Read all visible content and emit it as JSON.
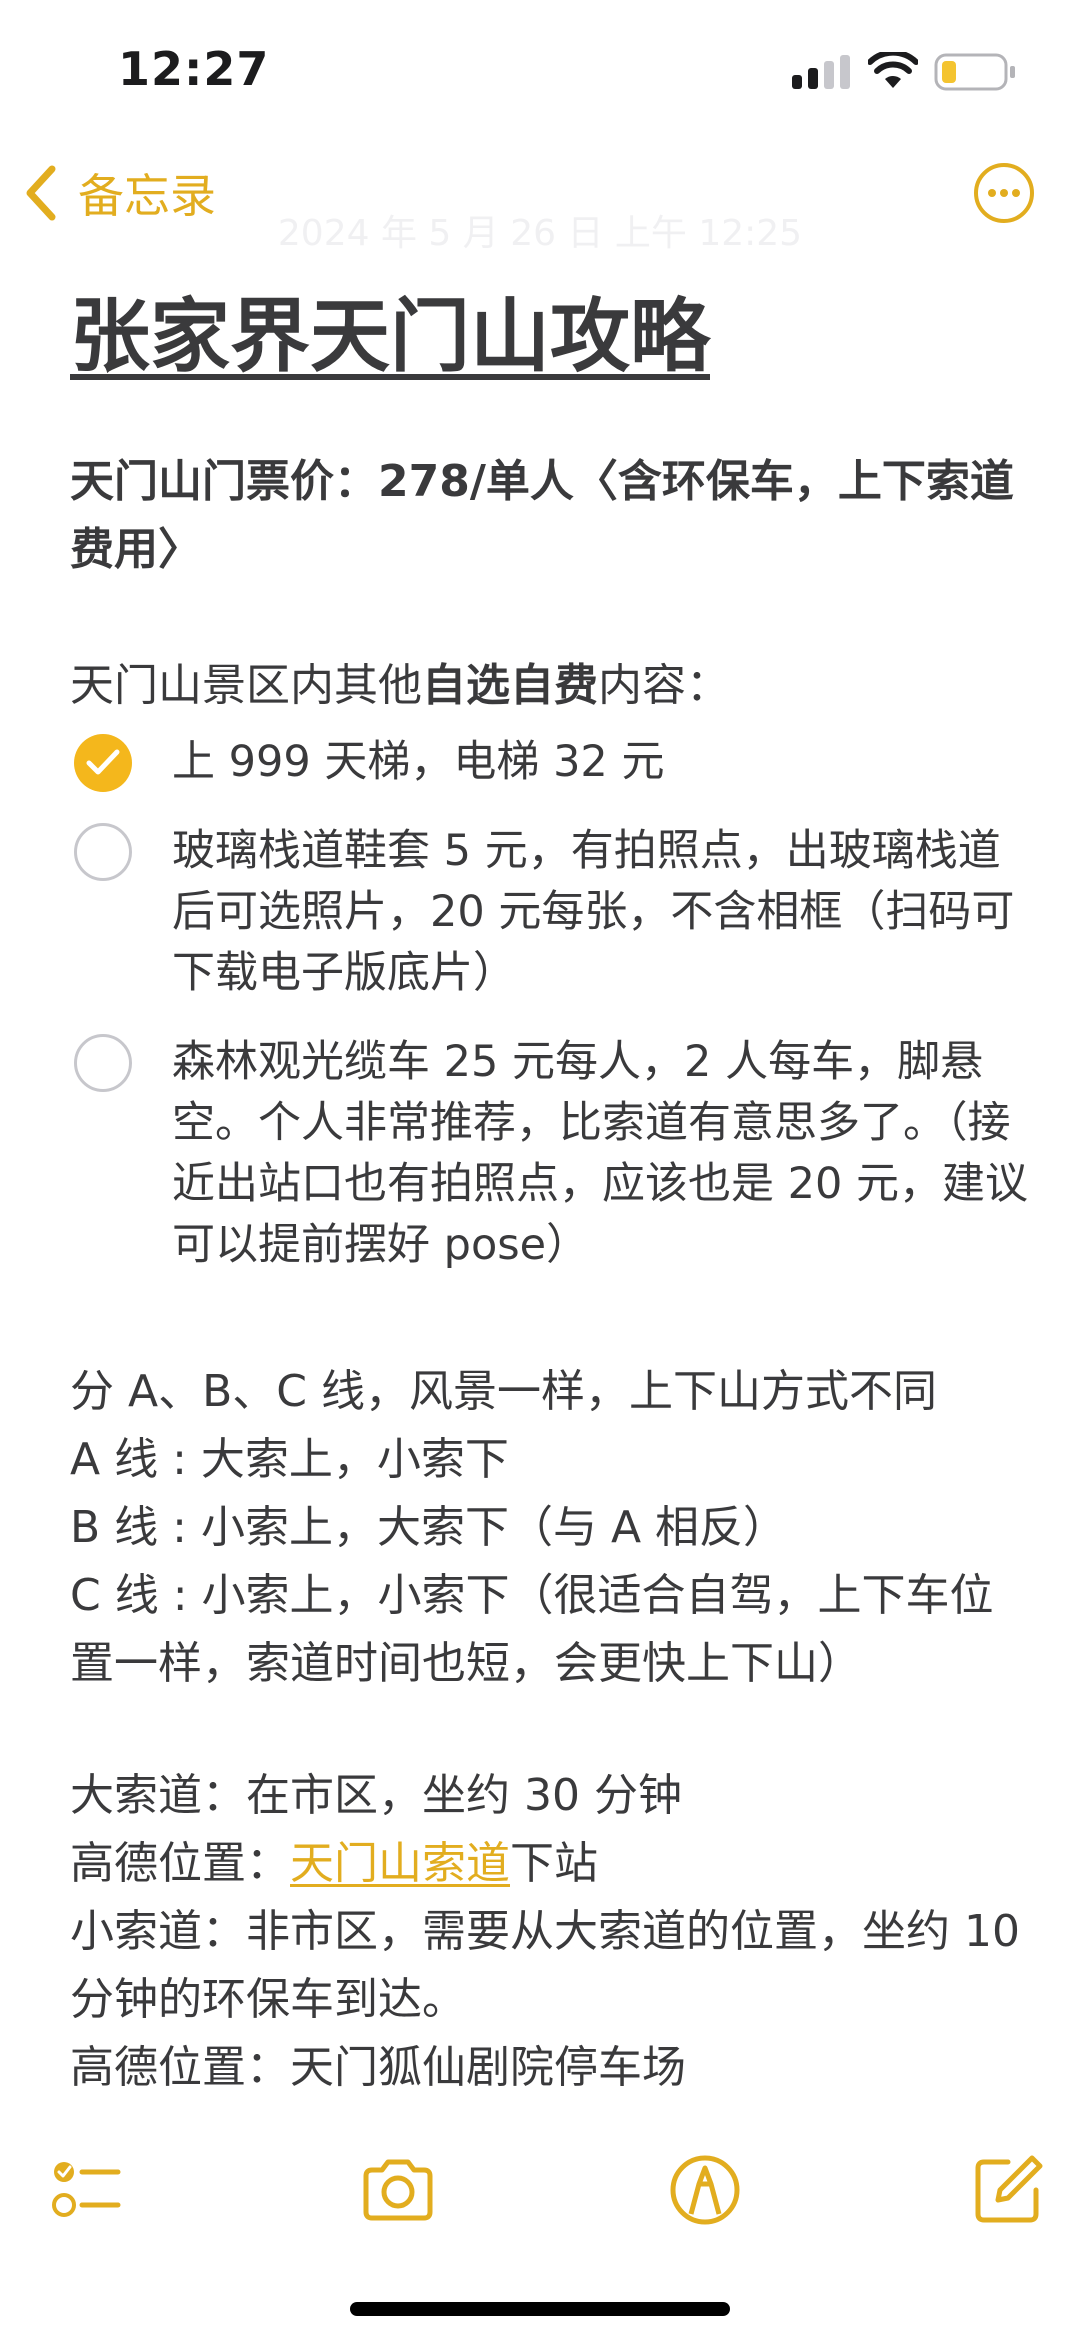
{
  "status_bar": {
    "time": "12:27"
  },
  "nav": {
    "back_label": "备忘录",
    "date_ghost": "2024 年 5 月 26 日 上午 12:25"
  },
  "note": {
    "title": "张家界天门山攻略",
    "ticket": {
      "label": "天门山门票价：278/单人〈含环保车，上下索道费用〉"
    },
    "optional": {
      "prefix": "天门山景区内其他",
      "emphasis": "自选自费",
      "suffix": "内容："
    },
    "checklist": [
      {
        "text": "上 999 天梯，电梯 32 元",
        "checked": true
      },
      {
        "text": "玻璃栈道鞋套 5 元，有拍照点，出玻璃栈道后可选照片，20 元每张，不含相框（扫码可下载电子版底片）",
        "checked": false
      },
      {
        "text": "森林观光缆车 25 元每人，2 人每车，脚悬空。个人非常推荐，比索道有意思多了。（接近出站口也有拍照点，应该也是 20 元，建议可以提前摆好 pose）",
        "checked": false
      }
    ],
    "routes": {
      "intro": "分 A、B、C 线，风景一样，上下山方式不同",
      "line_a": "A 线 : 大索上，小索下",
      "line_b": "B 线 : 小索上，大索下（与 A 相反）",
      "line_c": "C 线 : 小索上，小索下（很适合自驾，上下车位置一样，索道时间也短，会更快上下山）"
    },
    "cableway": {
      "big": "大索道：在市区，坐约 30 分钟",
      "big_loc_prefix": "高德位置：",
      "big_loc_link": "天门山索道",
      "big_loc_suffix": "下站",
      "small": "小索道：非市区，需要从大索道的位置，坐约 10 分钟的环保车到达。",
      "small_loc": "高德位置：天门狐仙剧院停车场"
    }
  },
  "colors": {
    "accent": "#e2ad1f",
    "text": "#3a3a3c"
  },
  "toolbar": {
    "icons": [
      "checklist-icon",
      "camera-icon",
      "markup-icon",
      "compose-icon"
    ]
  }
}
